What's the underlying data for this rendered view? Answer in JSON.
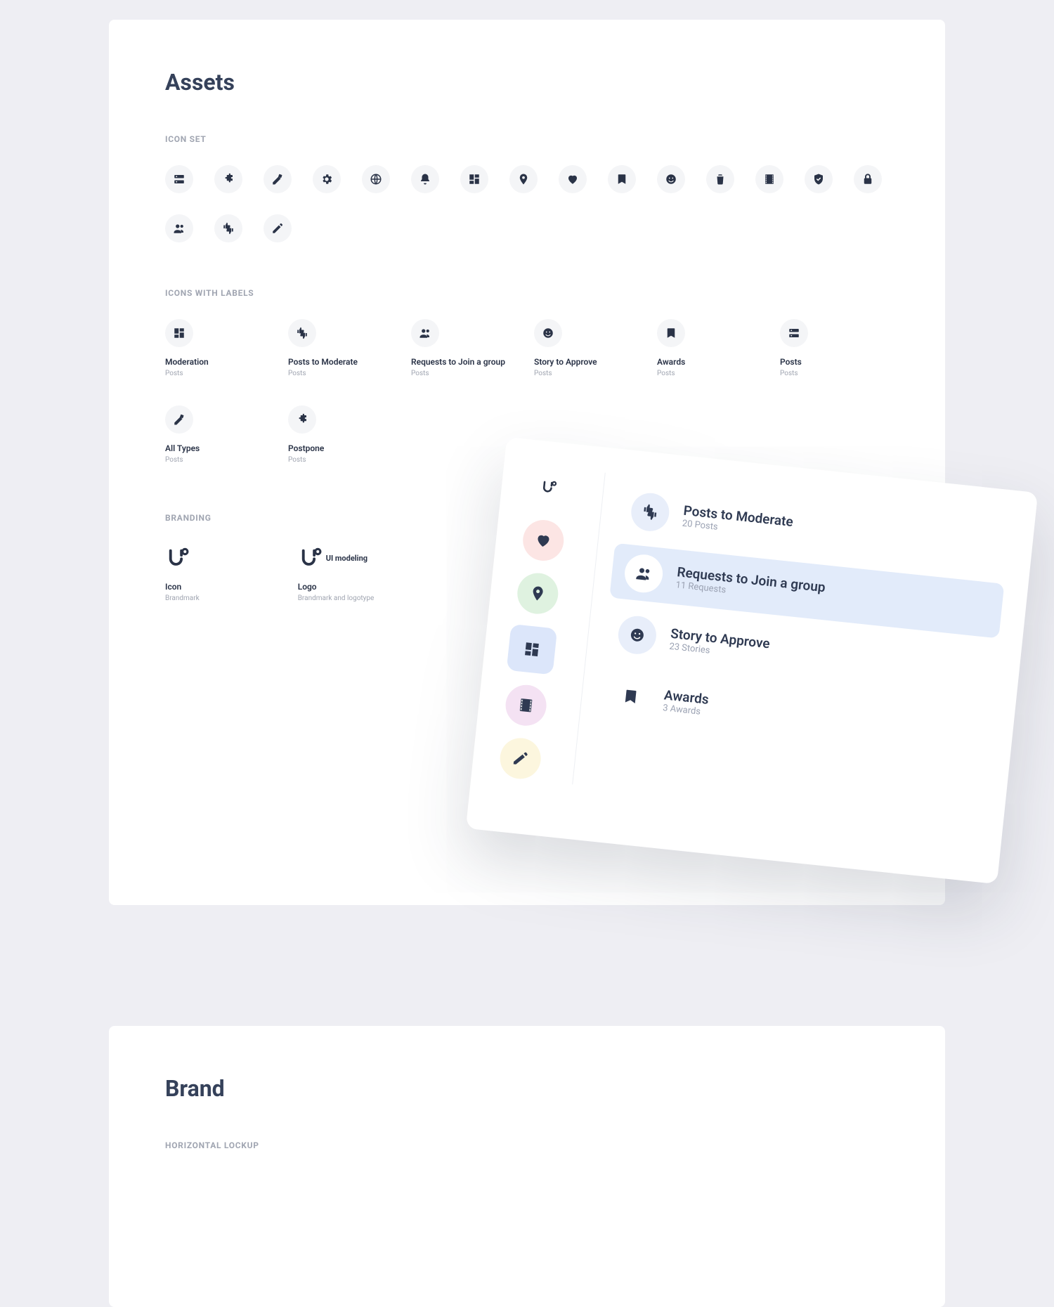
{
  "assets": {
    "title": "Assets",
    "section_icon_set": "ICON SET",
    "section_icons_labels": "ICONS WITH LABELS",
    "section_branding": "BRANDING",
    "icon_set": [
      "server",
      "puzzle",
      "style",
      "gear",
      "globe",
      "bell",
      "dashboard",
      "pin",
      "heart",
      "bookmark",
      "face",
      "trash",
      "film",
      "shield",
      "lock",
      "group",
      "thumbs",
      "edit"
    ],
    "labeled": [
      {
        "icon": "dashboard",
        "label": "Moderation",
        "sub": "Posts"
      },
      {
        "icon": "thumbs",
        "label": "Posts to Moderate",
        "sub": "Posts"
      },
      {
        "icon": "group",
        "label": "Requests to Join a group",
        "sub": "Posts"
      },
      {
        "icon": "face",
        "label": "Story to Approve",
        "sub": "Posts"
      },
      {
        "icon": "bookmark",
        "label": "Awards",
        "sub": "Posts"
      },
      {
        "icon": "server",
        "label": "Posts",
        "sub": "Posts"
      },
      {
        "icon": "style",
        "label": "All Types",
        "sub": "Posts"
      },
      {
        "icon": "puzzle",
        "label": "Postpone",
        "sub": "Posts"
      }
    ],
    "branding": {
      "icon": {
        "label": "Icon",
        "sub": "Brandmark"
      },
      "logo": {
        "label": "Logo",
        "sub": "Brandmark and logotype",
        "wordmark": "UI modeling"
      }
    }
  },
  "mock": {
    "items": [
      {
        "icon": "thumbs",
        "title": "Posts to Moderate",
        "sub": "20 Posts",
        "active": false,
        "chip_bg": "#E8EEFA"
      },
      {
        "icon": "group",
        "title": "Requests to Join a group",
        "sub": "11 Requests",
        "active": true,
        "chip_bg": "#FFFFFF"
      },
      {
        "icon": "face",
        "title": "Story to Approve",
        "sub": "23 Stories",
        "active": false,
        "chip_bg": "#E8EEFA"
      },
      {
        "icon": "bookmark",
        "title": "Awards",
        "sub": "3 Awards",
        "active": false,
        "chip_bg": "#FFFFFF"
      }
    ]
  },
  "brand": {
    "title": "Brand",
    "section_horizontal": "HORIZONTAL LOCKUP"
  }
}
